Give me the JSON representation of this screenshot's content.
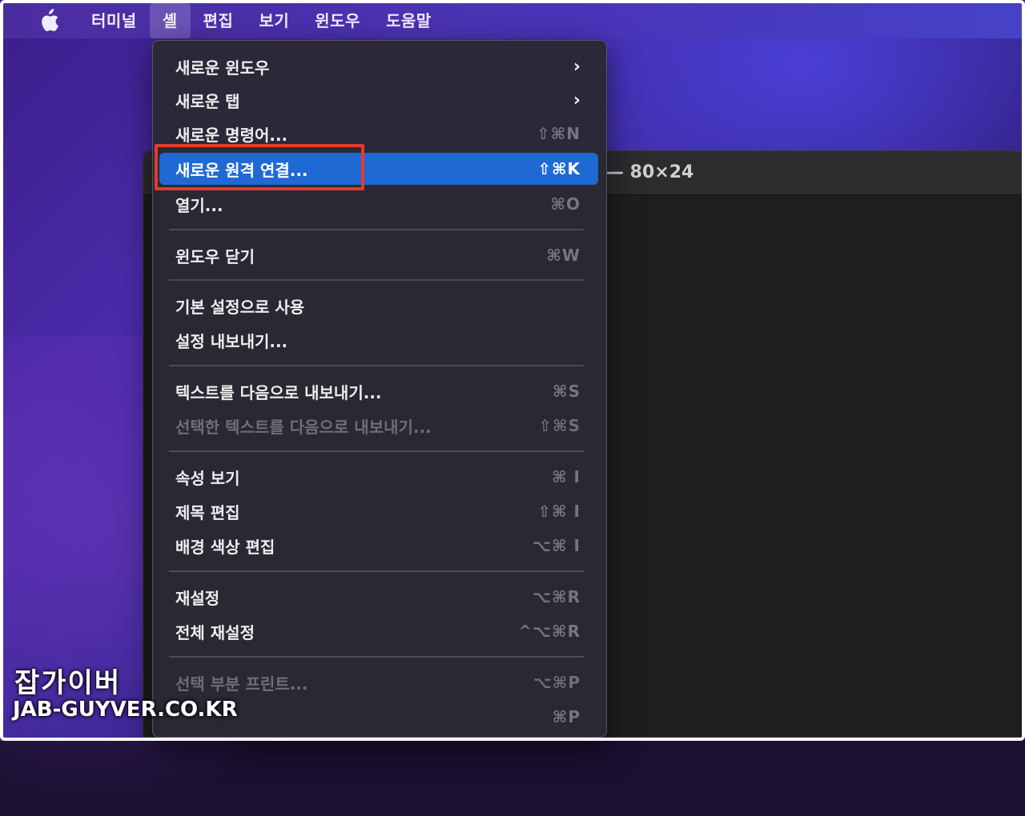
{
  "menubar": {
    "items": [
      "터미널",
      "셸",
      "편집",
      "보기",
      "윈도우",
      "도움말"
    ],
    "active_index": 1
  },
  "terminal_window": {
    "title_fragment": "— 80×24"
  },
  "menu": {
    "items": [
      {
        "label": "새로운 윈도우",
        "shortcut": "",
        "submenu": true,
        "disabled": false
      },
      {
        "label": "새로운 탭",
        "shortcut": "",
        "submenu": true,
        "disabled": false
      },
      {
        "label": "새로운 명령어...",
        "shortcut": "⇧⌘N",
        "submenu": false,
        "disabled": true
      },
      {
        "label": "새로운 원격 연결...",
        "shortcut": "⇧⌘K",
        "submenu": false,
        "disabled": false,
        "highlighted": true
      },
      {
        "label": "열기...",
        "shortcut": "⌘O",
        "submenu": false,
        "disabled": false
      },
      {
        "label": "윈도우 닫기",
        "shortcut": "⌘W",
        "submenu": false,
        "disabled": false
      },
      {
        "label": "기본 설정으로 사용",
        "shortcut": "",
        "submenu": false,
        "disabled": false
      },
      {
        "label": "설정 내보내기...",
        "shortcut": "",
        "submenu": false,
        "disabled": false
      },
      {
        "label": "텍스트를 다음으로 내보내기...",
        "shortcut": "⌘S",
        "submenu": false,
        "disabled": false
      },
      {
        "label": "선택한 텍스트를 다음으로 내보내기...",
        "shortcut": "⇧⌘S",
        "submenu": false,
        "disabled": true
      },
      {
        "label": "속성 보기",
        "shortcut": "⌘ I",
        "submenu": false,
        "disabled": false
      },
      {
        "label": "제목 편집",
        "shortcut": "⇧⌘ I",
        "submenu": false,
        "disabled": false
      },
      {
        "label": "배경 색상 편집",
        "shortcut": "⌥⌘ I",
        "submenu": false,
        "disabled": false
      },
      {
        "label": "재설정",
        "shortcut": "⌥⌘R",
        "submenu": false,
        "disabled": false
      },
      {
        "label": "전체 재설정",
        "shortcut": "^⌥⌘R",
        "submenu": false,
        "disabled": false
      },
      {
        "label": "선택 부분 프린트...",
        "shortcut": "⌥⌘P",
        "submenu": false,
        "disabled": true
      },
      {
        "label": "",
        "shortcut": "⌘P",
        "submenu": false,
        "disabled": false
      }
    ],
    "submenu_glyph": "›"
  },
  "watermark": {
    "line1": "잡가이버",
    "line2": "JAB-GUYVER.CO.KR"
  },
  "colors": {
    "highlight": "#1f69d4",
    "annotation_box": "#e03c2e",
    "menubar": "#4a34b8"
  }
}
